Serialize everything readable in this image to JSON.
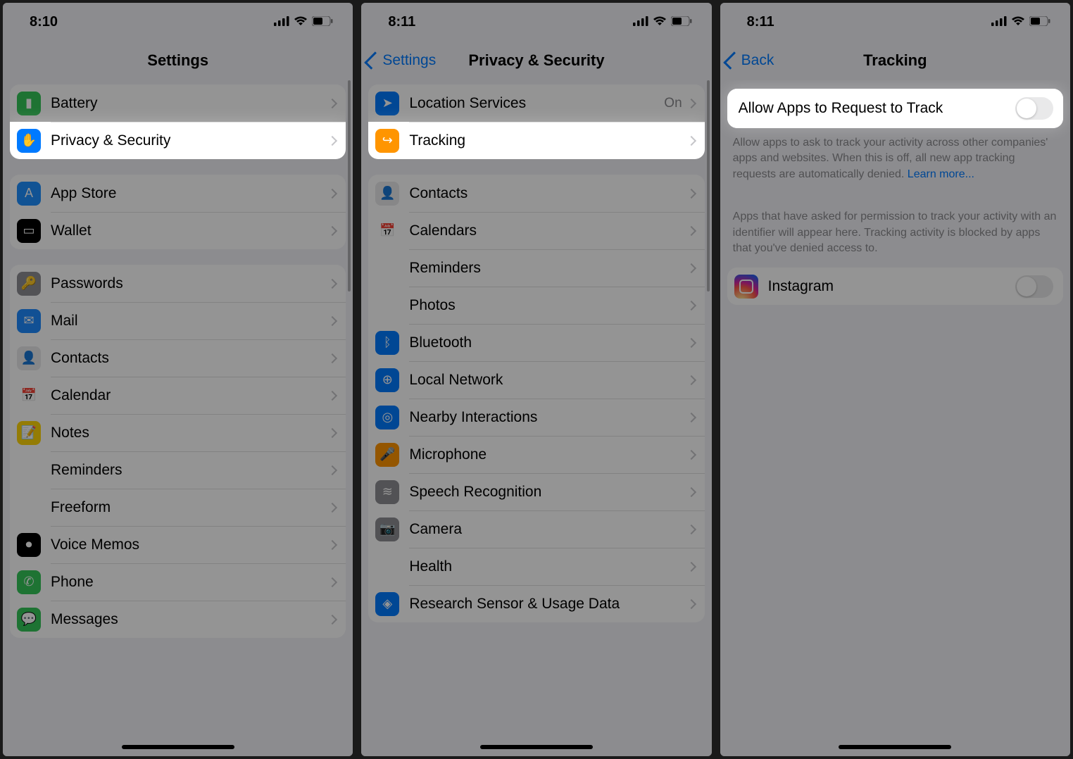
{
  "screen1": {
    "time": "8:10",
    "title": "Settings",
    "groups": [
      [
        {
          "label": "Battery",
          "icon": "#34c759",
          "glyph": "▮"
        },
        {
          "label": "Privacy & Security",
          "icon": "#007aff",
          "glyph": "✋",
          "highlight": true
        }
      ],
      [
        {
          "label": "App Store",
          "icon": "#1e90ff",
          "glyph": "A"
        },
        {
          "label": "Wallet",
          "icon": "#000",
          "glyph": "▭"
        }
      ],
      [
        {
          "label": "Passwords",
          "icon": "#8e8e93",
          "glyph": "🔑"
        },
        {
          "label": "Mail",
          "icon": "#1e8bff",
          "glyph": "✉"
        },
        {
          "label": "Contacts",
          "icon": "#e9e9ea",
          "glyph": "👤"
        },
        {
          "label": "Calendar",
          "icon": "#fff",
          "glyph": "📅"
        },
        {
          "label": "Notes",
          "icon": "#ffd60a",
          "glyph": "📝"
        },
        {
          "label": "Reminders",
          "icon": "#fff",
          "glyph": "⋮"
        },
        {
          "label": "Freeform",
          "icon": "#fff",
          "glyph": "∿"
        },
        {
          "label": "Voice Memos",
          "icon": "#000",
          "glyph": "⏺"
        },
        {
          "label": "Phone",
          "icon": "#34c759",
          "glyph": "✆"
        },
        {
          "label": "Messages",
          "icon": "#34c759",
          "glyph": "💬"
        }
      ]
    ]
  },
  "screen2": {
    "time": "8:11",
    "back": "Settings",
    "title": "Privacy & Security",
    "groups": [
      [
        {
          "label": "Location Services",
          "icon": "#007aff",
          "glyph": "➤",
          "value": "On"
        },
        {
          "label": "Tracking",
          "icon": "#ff9500",
          "glyph": "↪",
          "highlight": true
        }
      ],
      [
        {
          "label": "Contacts",
          "icon": "#e9e9ea",
          "glyph": "👤"
        },
        {
          "label": "Calendars",
          "icon": "#fff",
          "glyph": "📅"
        },
        {
          "label": "Reminders",
          "icon": "#fff",
          "glyph": "⋮"
        },
        {
          "label": "Photos",
          "icon": "#fff",
          "glyph": "✿"
        },
        {
          "label": "Bluetooth",
          "icon": "#007aff",
          "glyph": "ᛒ"
        },
        {
          "label": "Local Network",
          "icon": "#007aff",
          "glyph": "⊕"
        },
        {
          "label": "Nearby Interactions",
          "icon": "#007aff",
          "glyph": "◎"
        },
        {
          "label": "Microphone",
          "icon": "#ff9500",
          "glyph": "🎤"
        },
        {
          "label": "Speech Recognition",
          "icon": "#8e8e93",
          "glyph": "≋"
        },
        {
          "label": "Camera",
          "icon": "#8e8e93",
          "glyph": "📷"
        },
        {
          "label": "Health",
          "icon": "#fff",
          "glyph": "♥"
        },
        {
          "label": "Research Sensor & Usage Data",
          "icon": "#007aff",
          "glyph": "◈"
        }
      ]
    ]
  },
  "screen3": {
    "time": "8:11",
    "back": "Back",
    "title": "Tracking",
    "toggle_label": "Allow Apps to Request to Track",
    "footnote1": "Allow apps to ask to track your activity across other companies' apps and websites. When this is off, all new app tracking requests are automatically denied. ",
    "learn_more": "Learn more...",
    "footnote2": "Apps that have asked for permission to track your activity with an identifier will appear here. Tracking activity is blocked by apps that you've denied access to.",
    "app": "Instagram"
  }
}
